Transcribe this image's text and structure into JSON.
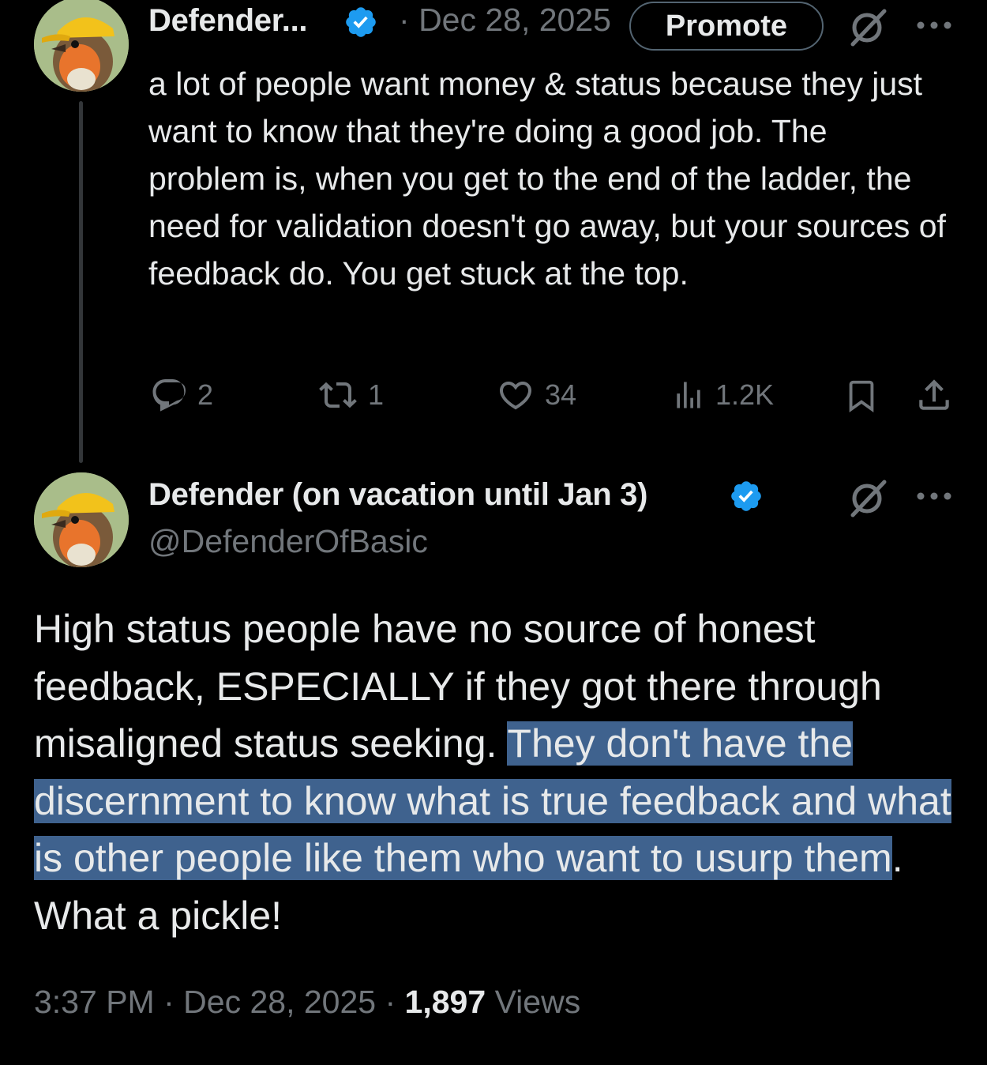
{
  "parent_tweet": {
    "display_name": "Defender...",
    "separator": "·",
    "date": "Dec 28, 2025",
    "promote_label": "Promote",
    "text": "a lot of people want money & status because they just want to know that they're doing a good job. The problem is, when you get to the end of the ladder, the need for validation doesn't go away, but your sources of feedback do. You get stuck at the top.",
    "actions": {
      "replies": "2",
      "reposts": "1",
      "likes": "34",
      "views": "1.2K"
    }
  },
  "main_tweet": {
    "display_name": "Defender (on vacation until Jan 3)",
    "handle": "@DefenderOfBasic",
    "text_before": "High status people have no source of honest feedback, ESPECIALLY if they got there through misaligned status seeking. ",
    "text_highlighted": "They don't have the discernment to know what is true feedback and what is other people like them who want to usurp them",
    "text_after": ". What a pickle!",
    "time": "3:37 PM",
    "date": "Dec 28, 2025",
    "views_count": "1,897",
    "views_label": "Views"
  },
  "colors": {
    "background": "#000000",
    "text": "#e7e9ea",
    "muted": "#71767b",
    "verified": "#1d9bf0",
    "selection": "#3f628e"
  },
  "icons": [
    "verified-badge-icon",
    "grok-icon",
    "more-icon",
    "reply-icon",
    "repost-icon",
    "like-icon",
    "views-icon",
    "bookmark-icon",
    "share-icon"
  ]
}
